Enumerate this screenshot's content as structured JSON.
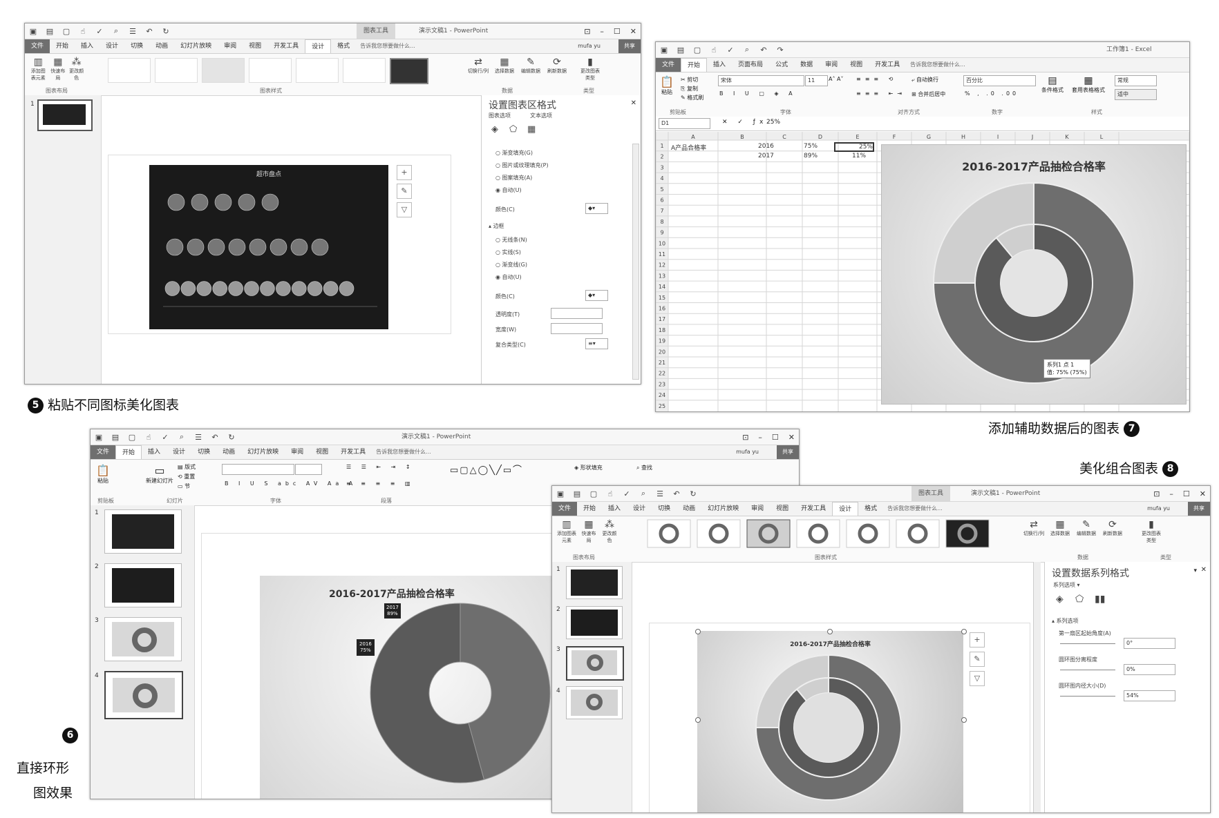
{
  "captions": {
    "c5_num": "5",
    "c5_text": "粘贴不同图标美化图表",
    "c7_num": "7",
    "c7_text": "添加辅助数据后的图表",
    "c8_num": "8",
    "c8_text": "美化组合图表",
    "c6_num": "6",
    "c6_line1": "直接环形",
    "c6_line2": "图效果"
  },
  "ppt1": {
    "ctx_tab": "图表工具",
    "title": "演示文稿1 - PowerPoint",
    "tabs": [
      "文件",
      "开始",
      "插入",
      "设计",
      "切换",
      "动画",
      "幻灯片放映",
      "审阅",
      "视图",
      "开发工具",
      "设计",
      "格式"
    ],
    "tell": "告诉我您想要做什么...",
    "user": "mufa yu",
    "share": "共享",
    "groups": {
      "layout": "图表布局",
      "styles": "图表样式",
      "data": "数据",
      "type": "类型"
    },
    "data_buttons": [
      "切换行/列",
      "选择数据",
      "编辑数据",
      "刷新数据"
    ],
    "type_button": "更改图表类型",
    "layout_buttons": [
      "添加图表元素",
      "快速布局",
      "更改颜色"
    ],
    "chart_title": "超市盘点",
    "pane": {
      "title": "设置图表区格式",
      "tab1": "图表选项",
      "tab2": "文本选项",
      "fill": [
        "渐变填充(G)",
        "图片或纹理填充(P)",
        "图案填充(A)",
        "自动(U)"
      ],
      "color": "颜色(C)",
      "border": "边框",
      "border_opts": [
        "无线条(N)",
        "实线(S)",
        "渐变线(G)",
        "自动(U)"
      ],
      "transparency": "透明度(T)",
      "width": "宽度(W)",
      "compound": "复合类型(C)"
    }
  },
  "excel": {
    "title": "工作簿1 - Excel",
    "tabs": [
      "文件",
      "开始",
      "插入",
      "页面布局",
      "公式",
      "数据",
      "审阅",
      "视图",
      "开发工具"
    ],
    "tell": "告诉我您想要做什么...",
    "font": "宋体",
    "size": "11",
    "numfmt": "百分比",
    "style": "常规",
    "style2": "适中",
    "wrap": "自动换行",
    "merge": "合并后居中",
    "groups": [
      "剪贴板",
      "字体",
      "对齐方式",
      "数字",
      "样式"
    ],
    "clip": [
      "粘贴",
      "剪切",
      "复制",
      "格式刷"
    ],
    "style_btns": [
      "条件格式",
      "套用表格格式"
    ],
    "namebox": "D1",
    "formula": "25%",
    "cols": [
      "A",
      "B",
      "C",
      "D",
      "E",
      "F",
      "G",
      "H",
      "I",
      "J",
      "K",
      "L"
    ],
    "rows": [
      "1",
      "2",
      "3",
      "4",
      "5",
      "6",
      "7",
      "8",
      "9",
      "10",
      "11",
      "12",
      "13",
      "14",
      "15",
      "16",
      "17",
      "18",
      "19",
      "20",
      "21",
      "22",
      "23",
      "24",
      "25"
    ],
    "cells": {
      "a1": "A产品合格率",
      "b1": "2016",
      "c1": "75%",
      "d1": "25%",
      "b2": "2017",
      "c2": "89%",
      "d2": "11%"
    },
    "chart_title": "2016-2017产品抽检合格率",
    "tooltip1": "系列1 点 1",
    "tooltip2": "值: 75% (75%)"
  },
  "ppt2": {
    "title": "演示文稿1 - PowerPoint",
    "tabs": [
      "文件",
      "开始",
      "插入",
      "设计",
      "切换",
      "动画",
      "幻灯片放映",
      "审阅",
      "视图",
      "开发工具"
    ],
    "tell": "告诉我您想要做什么...",
    "user": "mufa yu",
    "share": "共享",
    "groups": [
      "剪贴板",
      "幻灯片",
      "字体",
      "段落"
    ],
    "paste": "粘贴",
    "new_slide": "新建幻灯片",
    "layout": "版式",
    "reset": "重置",
    "section": "节",
    "shape_fill": "形状填充",
    "find": "查找",
    "slide_nums": [
      "1",
      "2",
      "3",
      "4"
    ],
    "chart_title": "2016-2017产品抽检合格率",
    "label_2017": "2017",
    "label_2017v": "89%",
    "label_2016": "2016",
    "label_2016v": "75%"
  },
  "ppt3": {
    "ctx_tab": "图表工具",
    "title": "演示文稿1 - PowerPoint",
    "tabs": [
      "文件",
      "开始",
      "插入",
      "设计",
      "切换",
      "动画",
      "幻灯片放映",
      "审阅",
      "视图",
      "开发工具",
      "设计",
      "格式"
    ],
    "tell": "告诉我您想要做什么...",
    "user": "mufa yu",
    "share": "共享",
    "groups": {
      "layout": "图表布局",
      "styles": "图表样式",
      "data": "数据",
      "type": "类型"
    },
    "layout_buttons": [
      "添加图表元素",
      "快速布局",
      "更改颜色"
    ],
    "data_buttons": [
      "切换行/列",
      "选择数据",
      "编辑数据",
      "刷新数据"
    ],
    "type_button": "更改图表类型",
    "slide_nums": [
      "1",
      "2",
      "3",
      "4"
    ],
    "chart_title": "2016-2017产品抽检合格率",
    "pane": {
      "title": "设置数据系列格式",
      "sub": "系列选项",
      "section": "系列选项",
      "angle_label": "第一扇区起始角度(A)",
      "angle_val": "0°",
      "explode_label": "圆环图分离程度",
      "explode_val": "0%",
      "hole_label": "圆环图内径大小(D)",
      "hole_val": "54%"
    }
  },
  "colors": {
    "ribbon_dark": "#6f6f6f",
    "ring_outer": "#6e6e6e",
    "ring_inner": "#5a5a5a",
    "ring_light": "#cfcfcf"
  }
}
